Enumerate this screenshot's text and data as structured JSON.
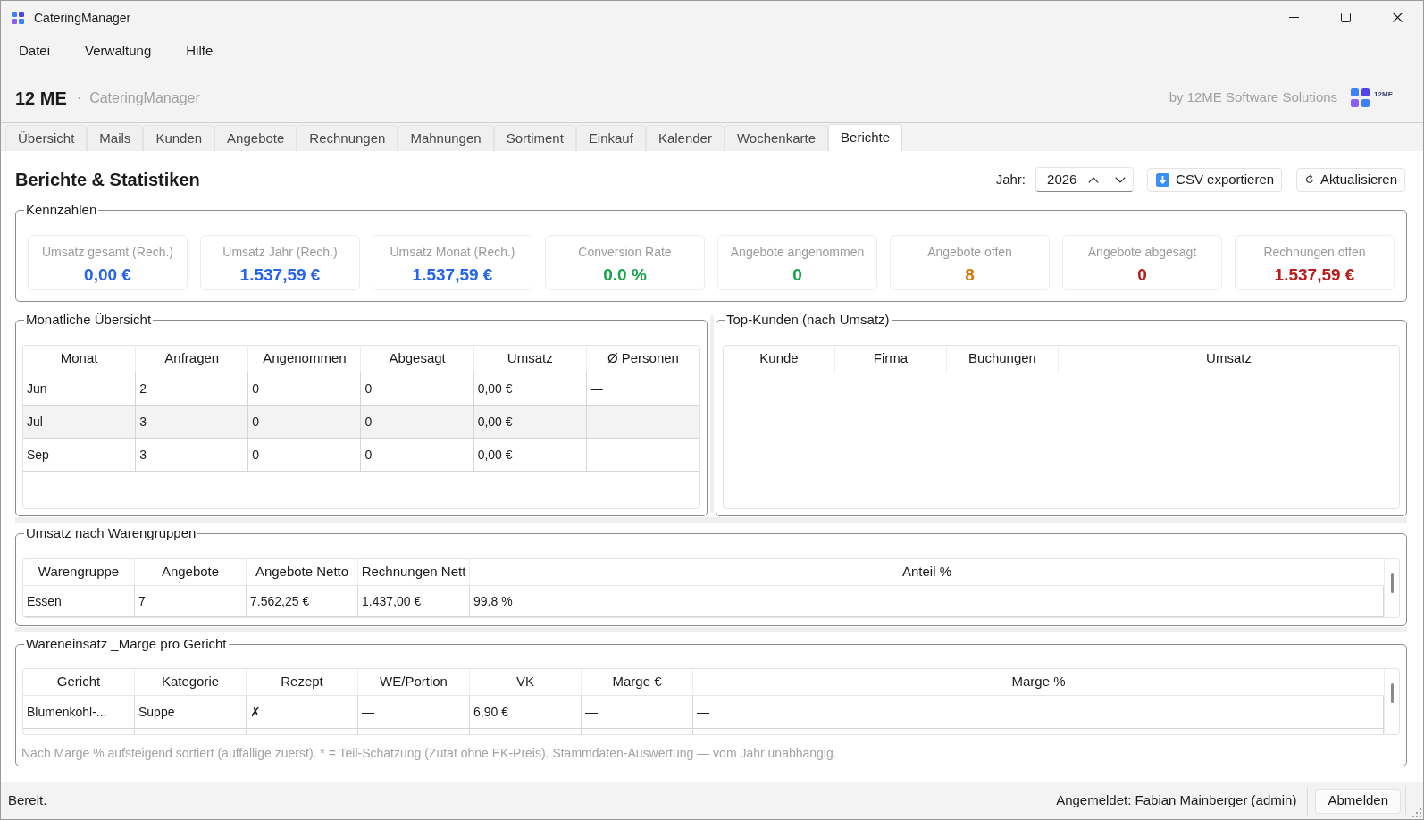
{
  "window": {
    "title": "CateringManager"
  },
  "menu": [
    "Datei",
    "Verwaltung",
    "Hilfe"
  ],
  "header": {
    "brand": "12 ME",
    "separator": "·",
    "app_name": "CateringManager",
    "byline": "by 12ME Software Solutions",
    "logo_text": "12ME"
  },
  "tabs": [
    {
      "label": "Übersicht",
      "selected": false
    },
    {
      "label": "Mails",
      "selected": false
    },
    {
      "label": "Kunden",
      "selected": false
    },
    {
      "label": "Angebote",
      "selected": false
    },
    {
      "label": "Rechnungen",
      "selected": false
    },
    {
      "label": "Mahnungen",
      "selected": false
    },
    {
      "label": "Sortiment",
      "selected": false
    },
    {
      "label": "Einkauf",
      "selected": false
    },
    {
      "label": "Kalender",
      "selected": false
    },
    {
      "label": "Wochenkarte",
      "selected": false
    },
    {
      "label": "Berichte",
      "selected": true
    }
  ],
  "toolbar": {
    "title": "Berichte & Statistiken",
    "year_label": "Jahr:",
    "year": "2026",
    "buttons": [
      {
        "label": "CSV exportieren",
        "kind": "export"
      },
      {
        "label": "Aktualisieren",
        "kind": "refresh"
      }
    ]
  },
  "kennzahlen": {
    "title": "Kennzahlen",
    "cards": [
      {
        "label": "Umsatz gesamt (Rech.)",
        "value": "0,00 €",
        "color": "#2563eb"
      },
      {
        "label": "Umsatz Jahr (Rech.)",
        "value": "1.537,59 €",
        "color": "#2563eb"
      },
      {
        "label": "Umsatz Monat (Rech.)",
        "value": "1.537,59 €",
        "color": "#2563eb"
      },
      {
        "label": "Conversion Rate",
        "value": "0.0 %",
        "color": "#16a34a"
      },
      {
        "label": "Angebote angenommen",
        "value": "0",
        "color": "#16a34a"
      },
      {
        "label": "Angebote offen",
        "value": "8",
        "color": "#d97706"
      },
      {
        "label": "Angebote abgesagt",
        "value": "0",
        "color": "#b91c1c"
      },
      {
        "label": "Rechnungen offen",
        "value": "1.537,59 €",
        "color": "#b91c1c"
      }
    ]
  },
  "monthly_overview": {
    "title": "Monatliche Übersicht",
    "columns": [
      "Monat",
      "Anfragen",
      "Angenommen",
      "Abgesagt",
      "Umsatz",
      "Ø Personen"
    ],
    "rows": [
      [
        "Jun",
        "2",
        "0",
        "0",
        "0,00 €",
        "—"
      ],
      [
        "Jul",
        "3",
        "0",
        "0",
        "0,00 €",
        "—"
      ],
      [
        "Sep",
        "3",
        "0",
        "0",
        "0,00 €",
        "—"
      ]
    ]
  },
  "top_customers": {
    "title": "Top-Kunden (nach Umsatz)",
    "columns": [
      "Kunde",
      "Firma",
      "Buchungen",
      "Umsatz"
    ]
  },
  "product_groups": {
    "title": "Umsatz nach Warengruppen",
    "columns": [
      "Warengruppe",
      "Angebote",
      "Angebote Netto",
      "Rechnungen Nett",
      "Anteil %"
    ],
    "rows": [
      [
        "Essen",
        "7",
        "7.562,25 €",
        "1.437,00 €",
        "99.8 %"
      ]
    ]
  },
  "dish_margins": {
    "title": "Wareneinsatz _Marge pro Gericht",
    "columns": [
      "Gericht",
      "Kategorie",
      "Rezept",
      "WE/Portion",
      "VK",
      "Marge €",
      "Marge %"
    ],
    "rows": [
      [
        "Blumenkohl-...",
        "Suppe",
        "✗",
        "—",
        "6,90 €",
        "—",
        "—"
      ]
    ],
    "note": "Nach Marge % aufsteigend sortiert (auffällige zuerst). * = Teil-Schätzung (Zutat ohne EK-Preis). Stammdaten-Auswertung — vom Jahr unabhängig."
  },
  "status_bar": {
    "message": "Bereit.",
    "user": "Angemeldet: Fabian Mainberger (admin)",
    "logout": "Abmelden"
  }
}
